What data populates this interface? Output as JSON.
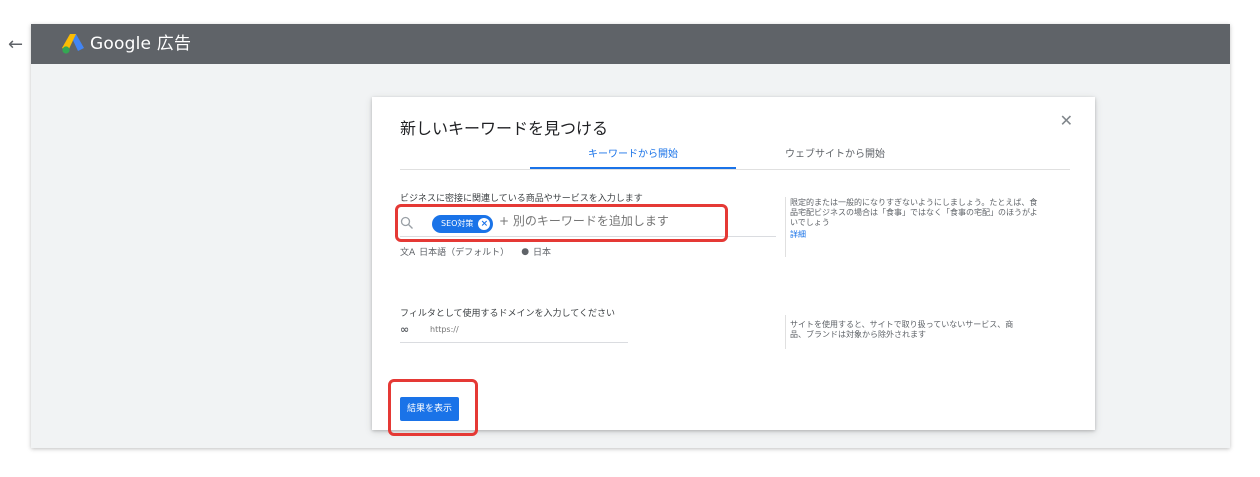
{
  "header": {
    "back_icon": "arrow-left-icon",
    "brand": "Google 広告",
    "logo_colors": [
      "#fbbc04",
      "#4285f4",
      "#34a853"
    ]
  },
  "dialog": {
    "title": "新しいキーワードを見つける",
    "tabs": [
      {
        "label": "キーワードから開始",
        "active": true
      },
      {
        "label": "ウェブサイトから開始",
        "active": false
      }
    ],
    "keywords": {
      "label": "ビジネスに密接に関連している商品やサービスを入力します",
      "chip": "SEO対策",
      "placeholder": "+ 別のキーワードを追加します",
      "language": "日本語（デフォルト）",
      "location": "日本",
      "hint": "限定的または一般的になりすぎないようにしましょう。たとえば、食品宅配ビジネスの場合は「食事」ではなく「食事の宅配」のほうがよいでしょう",
      "hint_link": "詳細"
    },
    "domain": {
      "label": "フィルタとして使用するドメインを入力してください",
      "placeholder": "https://",
      "hint": "サイトを使用すると、サイトで取り扱っていないサービス、商品、ブランドは対象から除外されます"
    },
    "submit_label": "結果を表示"
  },
  "colors": {
    "accent": "#1a73e8",
    "highlight": "#e53935",
    "topbar": "#5f6368"
  }
}
